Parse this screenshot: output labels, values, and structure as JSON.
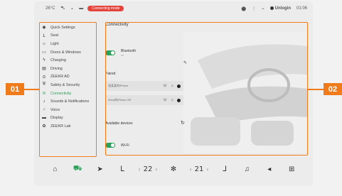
{
  "statusbar": {
    "temp": "26°C",
    "icons": [
      "⛍",
      "⌁",
      "▬"
    ],
    "connect_label": "Connecting mode",
    "right": {
      "location_icon": "location-icon",
      "user_label": "Unlogin",
      "time": "01:06"
    }
  },
  "sidebar": {
    "items": [
      {
        "label": "Quick Settings",
        "icon": "toggle-icon"
      },
      {
        "label": "Seat",
        "icon": "seat-icon"
      },
      {
        "label": "Light",
        "icon": "light-icon"
      },
      {
        "label": "Doors & Windows",
        "icon": "door-icon"
      },
      {
        "label": "Charging",
        "icon": "charging-icon"
      },
      {
        "label": "Driving",
        "icon": "driving-icon"
      },
      {
        "label": "ZEEKR AD",
        "icon": "steering-icon"
      },
      {
        "label": "Safety & Security",
        "icon": "shield-icon"
      },
      {
        "label": "Connectivity",
        "icon": "wifi-icon",
        "active": true
      },
      {
        "label": "Sounds & Notifications",
        "icon": "sound-icon"
      },
      {
        "label": "Voice",
        "icon": "mic-icon"
      },
      {
        "label": "Display",
        "icon": "display-icon"
      },
      {
        "label": "ZEEKR Lab",
        "icon": "lab-icon"
      }
    ]
  },
  "main": {
    "title": "Connectivity",
    "bluetooth": {
      "label": "Bluetooth",
      "sub": "on"
    },
    "paired_label": "Paired",
    "devices": [
      {
        "name": "张某某的iPhone"
      },
      {
        "name": "Zhou的iPhone XR"
      }
    ],
    "available_label": "Available devices",
    "wifi": {
      "label": "Wi-Fi"
    }
  },
  "dock": {
    "left_temp": "22",
    "left_temp_unit": "°",
    "right_temp": "21",
    "right_temp_unit": "°"
  },
  "callouts": {
    "left": "01",
    "right": "02"
  },
  "colors": {
    "accent": "#2ca05a",
    "callout": "#f07b1a",
    "alert": "#e5423a"
  }
}
